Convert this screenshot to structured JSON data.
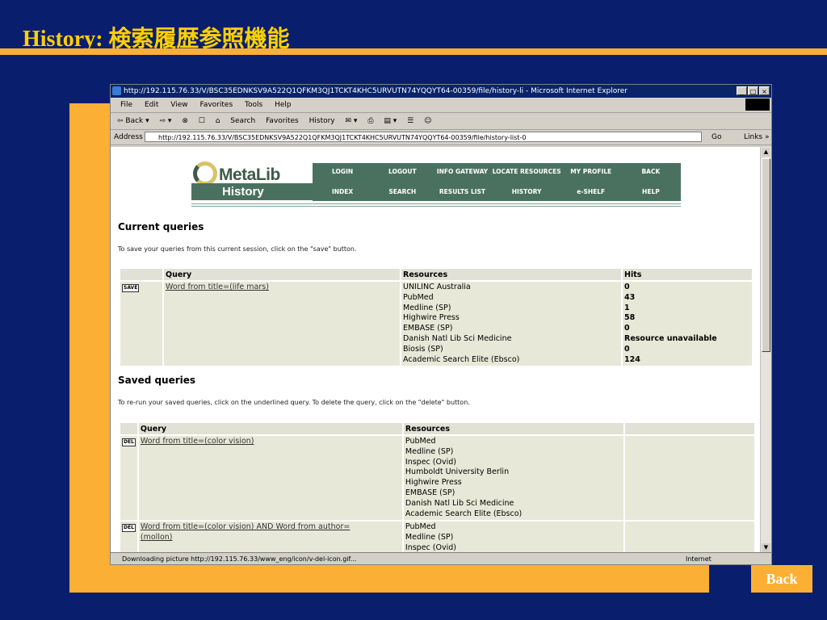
{
  "slide": {
    "title_en": "History:",
    "title_ja": "検索履歴参照機能",
    "back_label": "Back"
  },
  "browser": {
    "title": "http://192.115.76.33/V/BSC35EDNKSV9A522Q1QFKM3QJ1TCKT4KHC5URVUTN74YQQYT64-00359/file/history-li - Microsoft Internet Explorer",
    "controls": [
      "_",
      "□",
      "×"
    ],
    "menu": [
      "File",
      "Edit",
      "View",
      "Favorites",
      "Tools",
      "Help"
    ],
    "toolbar": [
      "⇦ Back ▾",
      "⇨ ▾",
      "⊗",
      "☐",
      "⌂",
      "Search",
      "Favorites",
      "History",
      "✉ ▾",
      "⎙",
      "▤ ▾",
      "☰",
      "☺"
    ],
    "address_label": "Address",
    "address_value": "http://192.115.76.33/V/BSC35EDNKSV9A522Q1QFKM3QJ1TCKT4KHC5URVUTN74YQQYT64-00359/file/history-list-0",
    "go_label": "Go",
    "links_label": "Links »",
    "status_text": "Downloading picture http://192.115.76.33/www_eng/icon/v-del-icon.gif...",
    "status_zone": "Internet"
  },
  "metalib": {
    "logo_text": "MetaLib",
    "logo_sub": "History",
    "nav_row1": [
      "LOGIN",
      "LOGOUT",
      "INFO GATEWAY",
      "LOCATE RESOURCES",
      "MY PROFILE",
      "BACK"
    ],
    "nav_row2": [
      "INDEX",
      "SEARCH",
      "RESULTS LIST",
      "HISTORY",
      "e-SHELF",
      "HELP"
    ]
  },
  "current": {
    "heading": "Current queries",
    "instructions": "To save your queries from this current session, click on the \"save\" button.",
    "headers": [
      "Query",
      "Resources",
      "Hits"
    ],
    "save_label": "SAVE",
    "query": "Word from title=(life mars)",
    "resources": "UNILINC Australia\nPubMed\nMedline (SP)\nHighwire Press\nEMBASE (SP)\nDanish Natl Lib Sci Medicine\nBiosis (SP)\nAcademic Search Elite (Ebsco)",
    "hits": "0\n43\n1\n58\n0\nResource unavailable\n0\n124"
  },
  "saved": {
    "heading": "Saved queries",
    "instructions": "To re-run your saved queries, click on the underlined query. To delete the query, click on the \"delete\" button.",
    "headers": [
      "Query",
      "Resources"
    ],
    "del_label": "DEL",
    "rows": [
      {
        "query": "Word from title=(color vision)",
        "resources": "PubMed\nMedline (SP)\nInspec (Ovid)\nHumboldt University Berlin\nHighwire Press\nEMBASE (SP)\nDanish Natl Lib Sci Medicine\nAcademic Search Elite (Ebsco)"
      },
      {
        "query": "Word from title=(color vision) AND Word from author=\n(mollon)",
        "resources": "PubMed\nMedline (SP)\nInspec (Ovid)"
      }
    ]
  }
}
